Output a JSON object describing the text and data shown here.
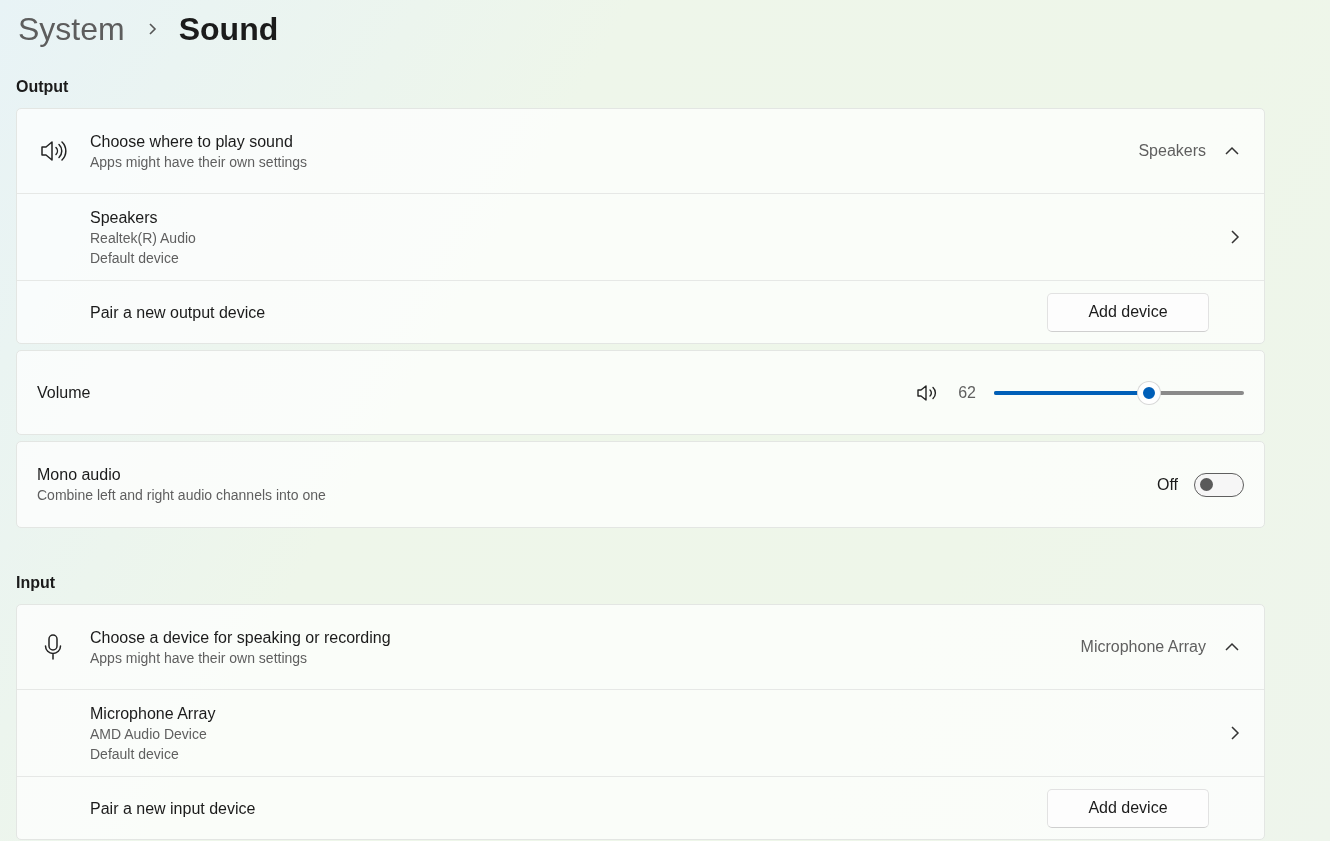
{
  "breadcrumb": {
    "parent": "System",
    "current": "Sound"
  },
  "sections": [
    {
      "heading": "Output",
      "cards": [
        {
          "kind": "chooser",
          "title": "Choose where to play sound",
          "subtitle": "Apps might have their own settings",
          "value": "Speakers",
          "expanded": true,
          "device": {
            "name": "Speakers",
            "lines": [
              "Realtek(R) Audio",
              "Default device"
            ]
          },
          "pair": {
            "label": "Pair a new output device",
            "button": "Add device"
          }
        },
        {
          "kind": "slider",
          "label": "Volume",
          "reading": "62",
          "level": 0.62
        },
        {
          "kind": "toggle",
          "title": "Mono audio",
          "subtitle": "Combine left and right audio channels into one",
          "state_label": "Off",
          "on": false
        }
      ]
    },
    {
      "heading": "Input",
      "cards": [
        {
          "kind": "chooser",
          "title": "Choose a device for speaking or recording",
          "subtitle": "Apps might have their own settings",
          "value": "Microphone Array",
          "expanded": true,
          "device": {
            "name": "Microphone Array",
            "lines": [
              "AMD Audio Device",
              "Default device"
            ]
          },
          "pair": {
            "label": "Pair a new input device",
            "button": "Add device"
          }
        }
      ]
    }
  ]
}
